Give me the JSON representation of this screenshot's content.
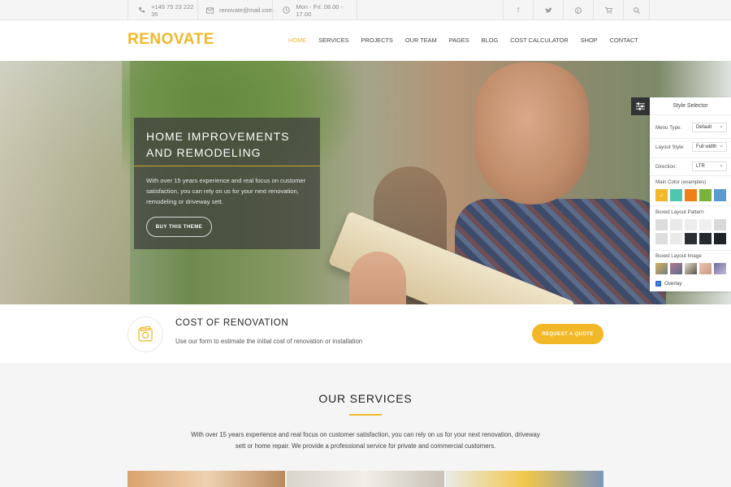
{
  "topbar": {
    "phone": "+149 75 23 222 35",
    "email": "renovate@mail.com",
    "hours": "Mon - Fri: 08.00 - 17.00",
    "social": [
      "f",
      "t",
      "p",
      "cart",
      "search"
    ]
  },
  "header": {
    "logo": "RENOVATE",
    "nav": [
      "HOME",
      "SERVICES",
      "PROJECTS",
      "OUR TEAM",
      "PAGES",
      "BLOG",
      "COST CALCULATOR",
      "SHOP",
      "CONTACT"
    ]
  },
  "hero": {
    "title": "HOME IMPROVEMENTS AND REMODELING",
    "text": "With over 15 years experience and real focus on customer satisfaction, you can rely on us for your next renovation, remodeling or driveway sett.",
    "button": "BUY THIS THEME"
  },
  "style_selector": {
    "title": "Style Selector",
    "menu_type_label": "Menu Type:",
    "menu_type_value": "Default",
    "layout_style_label": "Layout Style:",
    "layout_style_value": "Full width",
    "direction_label": "Direction:",
    "direction_value": "LTR",
    "main_color_label": "Main Color (examples)",
    "main_colors": [
      "#f2b827",
      "#4fc7b0",
      "#f07f1a",
      "#79b33c",
      "#5b9bd0"
    ],
    "boxed_pattern_label": "Boxed Layout Pattern",
    "boxed_image_label": "Boxed Layout Image",
    "overlay_label": "Overlay"
  },
  "cost": {
    "title": "COST OF RENOVATION",
    "text": "Use our form to estimate the initial cost of renovation or installation",
    "button": "REQUEST A QUOTE"
  },
  "services": {
    "title": "OUR SERVICES",
    "text": "With over 15 years experience and real focus on customer satisfaction, you can rely on us for your next renovation, driveway sett or home repair. We provide a professional service for private and commercial customers."
  },
  "colors": {
    "accent": "#f2b827"
  }
}
